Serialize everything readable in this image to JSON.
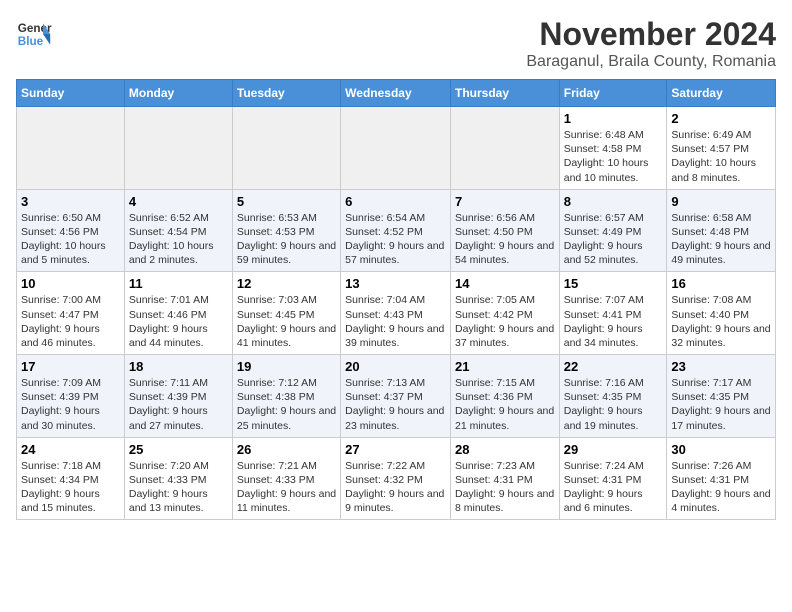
{
  "logo": {
    "line1": "General",
    "line2": "Blue"
  },
  "title": "November 2024",
  "location": "Baraganul, Braila County, Romania",
  "days_of_week": [
    "Sunday",
    "Monday",
    "Tuesday",
    "Wednesday",
    "Thursday",
    "Friday",
    "Saturday"
  ],
  "weeks": [
    [
      {
        "day": "",
        "info": ""
      },
      {
        "day": "",
        "info": ""
      },
      {
        "day": "",
        "info": ""
      },
      {
        "day": "",
        "info": ""
      },
      {
        "day": "",
        "info": ""
      },
      {
        "day": "1",
        "info": "Sunrise: 6:48 AM\nSunset: 4:58 PM\nDaylight: 10 hours and 10 minutes."
      },
      {
        "day": "2",
        "info": "Sunrise: 6:49 AM\nSunset: 4:57 PM\nDaylight: 10 hours and 8 minutes."
      }
    ],
    [
      {
        "day": "3",
        "info": "Sunrise: 6:50 AM\nSunset: 4:56 PM\nDaylight: 10 hours and 5 minutes."
      },
      {
        "day": "4",
        "info": "Sunrise: 6:52 AM\nSunset: 4:54 PM\nDaylight: 10 hours and 2 minutes."
      },
      {
        "day": "5",
        "info": "Sunrise: 6:53 AM\nSunset: 4:53 PM\nDaylight: 9 hours and 59 minutes."
      },
      {
        "day": "6",
        "info": "Sunrise: 6:54 AM\nSunset: 4:52 PM\nDaylight: 9 hours and 57 minutes."
      },
      {
        "day": "7",
        "info": "Sunrise: 6:56 AM\nSunset: 4:50 PM\nDaylight: 9 hours and 54 minutes."
      },
      {
        "day": "8",
        "info": "Sunrise: 6:57 AM\nSunset: 4:49 PM\nDaylight: 9 hours and 52 minutes."
      },
      {
        "day": "9",
        "info": "Sunrise: 6:58 AM\nSunset: 4:48 PM\nDaylight: 9 hours and 49 minutes."
      }
    ],
    [
      {
        "day": "10",
        "info": "Sunrise: 7:00 AM\nSunset: 4:47 PM\nDaylight: 9 hours and 46 minutes."
      },
      {
        "day": "11",
        "info": "Sunrise: 7:01 AM\nSunset: 4:46 PM\nDaylight: 9 hours and 44 minutes."
      },
      {
        "day": "12",
        "info": "Sunrise: 7:03 AM\nSunset: 4:45 PM\nDaylight: 9 hours and 41 minutes."
      },
      {
        "day": "13",
        "info": "Sunrise: 7:04 AM\nSunset: 4:43 PM\nDaylight: 9 hours and 39 minutes."
      },
      {
        "day": "14",
        "info": "Sunrise: 7:05 AM\nSunset: 4:42 PM\nDaylight: 9 hours and 37 minutes."
      },
      {
        "day": "15",
        "info": "Sunrise: 7:07 AM\nSunset: 4:41 PM\nDaylight: 9 hours and 34 minutes."
      },
      {
        "day": "16",
        "info": "Sunrise: 7:08 AM\nSunset: 4:40 PM\nDaylight: 9 hours and 32 minutes."
      }
    ],
    [
      {
        "day": "17",
        "info": "Sunrise: 7:09 AM\nSunset: 4:39 PM\nDaylight: 9 hours and 30 minutes."
      },
      {
        "day": "18",
        "info": "Sunrise: 7:11 AM\nSunset: 4:39 PM\nDaylight: 9 hours and 27 minutes."
      },
      {
        "day": "19",
        "info": "Sunrise: 7:12 AM\nSunset: 4:38 PM\nDaylight: 9 hours and 25 minutes."
      },
      {
        "day": "20",
        "info": "Sunrise: 7:13 AM\nSunset: 4:37 PM\nDaylight: 9 hours and 23 minutes."
      },
      {
        "day": "21",
        "info": "Sunrise: 7:15 AM\nSunset: 4:36 PM\nDaylight: 9 hours and 21 minutes."
      },
      {
        "day": "22",
        "info": "Sunrise: 7:16 AM\nSunset: 4:35 PM\nDaylight: 9 hours and 19 minutes."
      },
      {
        "day": "23",
        "info": "Sunrise: 7:17 AM\nSunset: 4:35 PM\nDaylight: 9 hours and 17 minutes."
      }
    ],
    [
      {
        "day": "24",
        "info": "Sunrise: 7:18 AM\nSunset: 4:34 PM\nDaylight: 9 hours and 15 minutes."
      },
      {
        "day": "25",
        "info": "Sunrise: 7:20 AM\nSunset: 4:33 PM\nDaylight: 9 hours and 13 minutes."
      },
      {
        "day": "26",
        "info": "Sunrise: 7:21 AM\nSunset: 4:33 PM\nDaylight: 9 hours and 11 minutes."
      },
      {
        "day": "27",
        "info": "Sunrise: 7:22 AM\nSunset: 4:32 PM\nDaylight: 9 hours and 9 minutes."
      },
      {
        "day": "28",
        "info": "Sunrise: 7:23 AM\nSunset: 4:31 PM\nDaylight: 9 hours and 8 minutes."
      },
      {
        "day": "29",
        "info": "Sunrise: 7:24 AM\nSunset: 4:31 PM\nDaylight: 9 hours and 6 minutes."
      },
      {
        "day": "30",
        "info": "Sunrise: 7:26 AM\nSunset: 4:31 PM\nDaylight: 9 hours and 4 minutes."
      }
    ]
  ]
}
